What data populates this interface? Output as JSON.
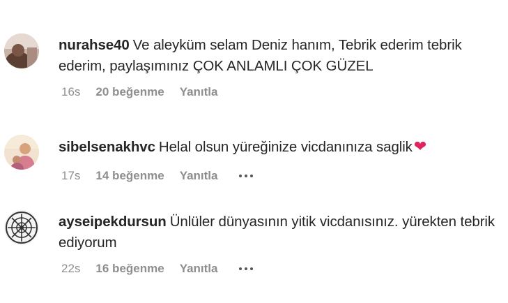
{
  "comments": [
    {
      "username": "nurahse40",
      "text": "Ve aleyküm selam Deniz hanım, Tebrik ederim tebrik ederim, paylaşımınız ÇOK ANLAMLI ÇOK GÜZEL",
      "time": "16s",
      "likes": "20 beğenme",
      "reply": "Yanıtla",
      "has_more": false,
      "emoji": ""
    },
    {
      "username": "sibelsenakhvc",
      "text": "Helal olsun yüreğinize vicdanınıza saglik",
      "time": "17s",
      "likes": "14 beğenme",
      "reply": "Yanıtla",
      "has_more": true,
      "emoji": "❤"
    },
    {
      "username": "ayseipekdursun",
      "text": "Ünlüler dünyasının yitik vicdanısınız. yürekten tebrik ediyorum",
      "time": "22s",
      "likes": "16 beğenme",
      "reply": "Yanıtla",
      "has_more": true,
      "emoji": ""
    }
  ],
  "icons": {
    "more": "more-horizontal-icon",
    "heart": "red-heart-emoji"
  },
  "colors": {
    "text": "#262626",
    "meta": "#8e8e8e",
    "heart": "#e0245e"
  }
}
